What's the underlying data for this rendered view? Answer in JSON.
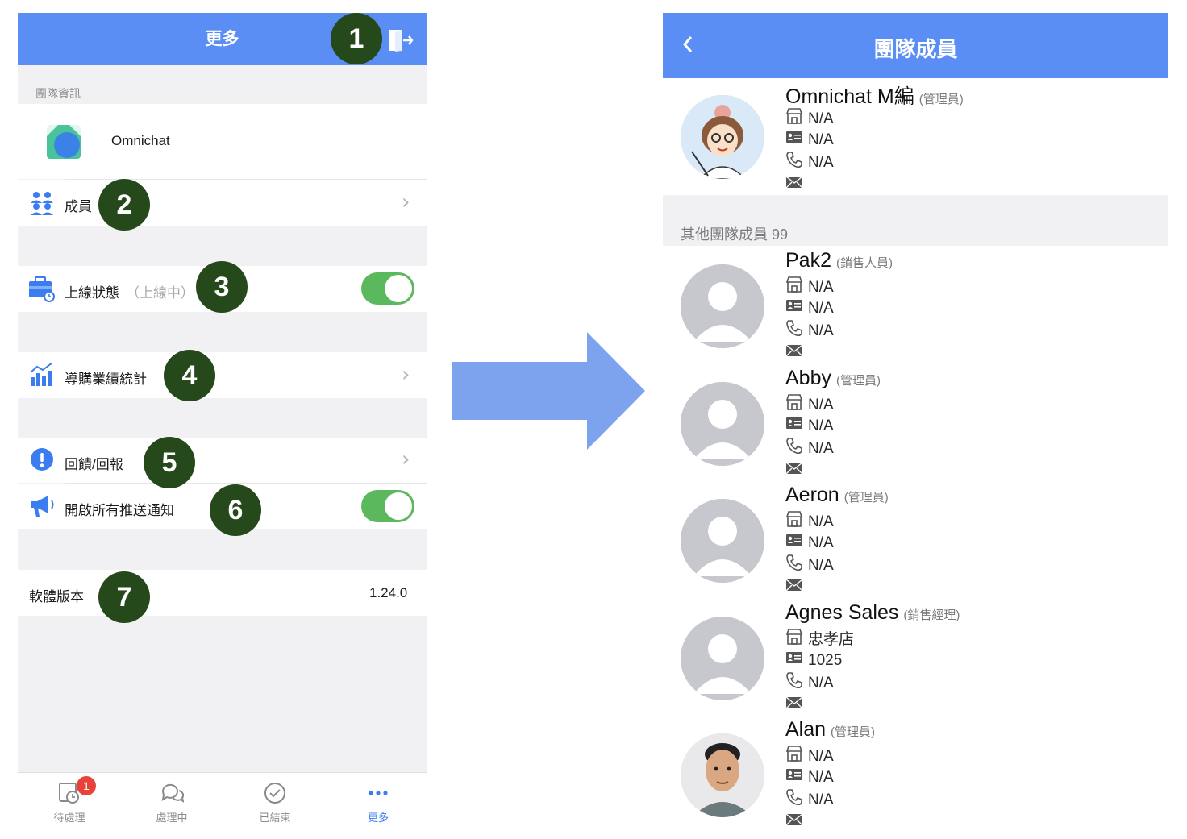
{
  "colors": {
    "accent": "#5b8ef4",
    "badge": "#26491c",
    "toggle_on": "#5cb85c",
    "notification": "#e8433a"
  },
  "left": {
    "title": "更多",
    "section_label": "團隊資訊",
    "team_name": "Omnichat",
    "rows": {
      "members": "成員",
      "online_status": "上線狀態",
      "online_state": "（上線中）",
      "sales_stats": "導購業績統計",
      "feedback": "回饋/回報",
      "push": "開啟所有推送通知",
      "version_label": "軟體版本",
      "version_value": "1.24.0"
    },
    "badges": [
      "1",
      "2",
      "3",
      "4",
      "5",
      "6",
      "7"
    ],
    "tabs": [
      {
        "label": "待處理",
        "icon": "clock-icon",
        "count": "1"
      },
      {
        "label": "處理中",
        "icon": "chat-icon"
      },
      {
        "label": "已結束",
        "icon": "check-circle-icon"
      },
      {
        "label": "更多",
        "icon": "more-dots-icon"
      }
    ]
  },
  "right": {
    "title": "團隊成員",
    "others_label": "其他團隊成員",
    "others_count": "99",
    "members": [
      {
        "name": "Omnichat M編",
        "role": "(管理員)",
        "store": "N/A",
        "id": "N/A",
        "phone": "N/A"
      },
      {
        "name": "Pak2",
        "role": "(銷售人員)",
        "store": "N/A",
        "id": "N/A",
        "phone": "N/A"
      },
      {
        "name": "Abby",
        "role": "(管理員)",
        "store": "N/A",
        "id": "N/A",
        "phone": "N/A"
      },
      {
        "name": "Aeron",
        "role": "(管理員)",
        "store": "N/A",
        "id": "N/A",
        "phone": "N/A"
      },
      {
        "name": "Agnes Sales",
        "role": "(銷售經理)",
        "store": "忠孝店",
        "id": "1025",
        "phone": "N/A"
      },
      {
        "name": "Alan",
        "role": "(管理員)",
        "store": "N/A",
        "id": "N/A",
        "phone": "N/A"
      }
    ]
  }
}
